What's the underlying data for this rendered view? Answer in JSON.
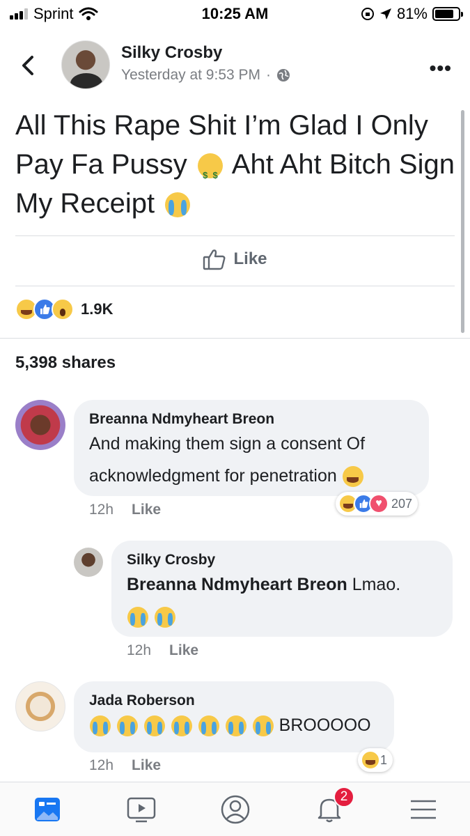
{
  "status_bar": {
    "carrier": "Sprint",
    "time": "10:25 AM",
    "battery": "81%",
    "battery_level": 0.81
  },
  "post": {
    "author": "Silky Crosby",
    "timestamp": "Yesterday at 9:53 PM",
    "separator": "·",
    "text_line1": "All This Rape Shit I’m Glad I Only",
    "text_line2_a": "Pay Fa Pussy",
    "text_line2_b": "Aht Aht Bitch Sign",
    "text_line3": "My Receipt",
    "like_label": "Like",
    "reaction_count": "1.9K",
    "shares": "5,398 shares",
    "icons": [
      "back-icon",
      "globe-icon",
      "more-icon",
      "like-thumb-icon"
    ]
  },
  "comments": [
    {
      "author": "Breanna Ndmyheart Breon",
      "text_line1": "And making them sign a consent Of",
      "text_line2": "acknowledgment for penetration",
      "time": "12h",
      "like_label": "Like",
      "reaction_count": "207"
    },
    {
      "author": "Silky Crosby",
      "mention": "Breanna Ndmyheart Breon",
      "text": "Lmao.",
      "time": "12h",
      "like_label": "Like"
    },
    {
      "author": "Jada Roberson",
      "text": "BROOOOO",
      "time": "12h",
      "like_label": "Like",
      "reaction_count": "1"
    }
  ],
  "bottom_nav": {
    "items": [
      "news-feed-icon",
      "watch-icon",
      "profile-icon",
      "notifications-icon",
      "menu-icon"
    ],
    "notification_badge": "2",
    "active_color": "#1877f2"
  }
}
